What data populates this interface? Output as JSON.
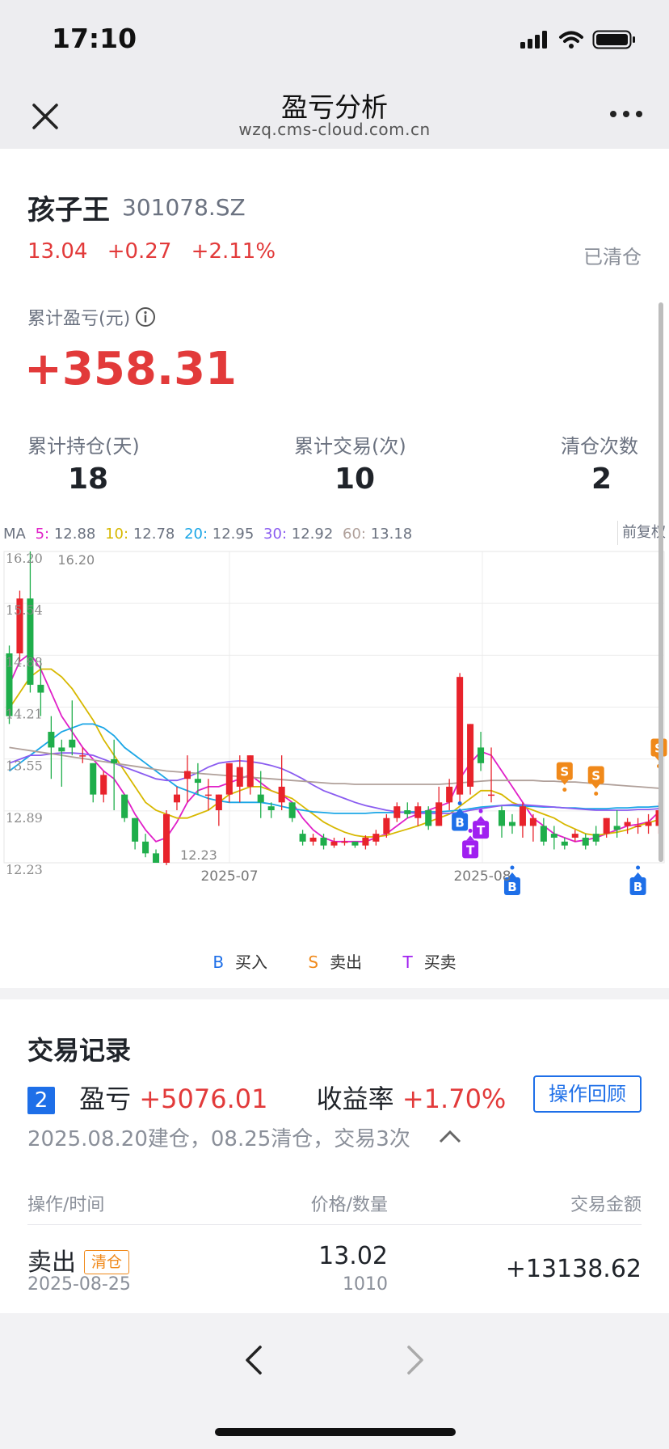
{
  "status_bar": {
    "time": "17:10"
  },
  "nav": {
    "title": "盈亏分析",
    "subtitle": "wzq.cms-cloud.com.cn"
  },
  "stock": {
    "name": "孩子王",
    "code": "301078.SZ",
    "price": "13.04",
    "change": "+0.27",
    "change_pct": "+2.11%",
    "status": "已清仓",
    "pl_label": "累计盈亏(元)",
    "pl_value": "+358.31"
  },
  "stats": [
    {
      "label": "累计持仓(天)",
      "value": "18"
    },
    {
      "label": "累计交易(次)",
      "value": "10"
    },
    {
      "label": "清仓次数",
      "value": "2"
    }
  ],
  "ma": {
    "prefix": "MA",
    "items": [
      {
        "label": "5:",
        "value": "12.88",
        "color": "#e020c8"
      },
      {
        "label": "10:",
        "value": "12.78",
        "color": "#d7b800"
      },
      {
        "label": "20:",
        "value": "12.95",
        "color": "#1aa6e6"
      },
      {
        "label": "30:",
        "value": "12.92",
        "color": "#8a5cf0"
      },
      {
        "label": "60:",
        "value": "13.18",
        "color": "#b0a09a"
      }
    ],
    "adjust": "前复权"
  },
  "chart_data": {
    "type": "candlestick",
    "y_ticks": [
      "16.20",
      "15.54",
      "14.88",
      "14.21",
      "13.55",
      "12.89",
      "12.23"
    ],
    "ylim": [
      12.23,
      16.2
    ],
    "x_labels": [
      "2025-07",
      "2025-08"
    ],
    "max_label": "16.20",
    "min_label": "12.23",
    "candles": [
      [
        14.9,
        14.1,
        15.0,
        14.0
      ],
      [
        14.9,
        15.6,
        15.7,
        14.8
      ],
      [
        15.6,
        14.5,
        16.2,
        14.4
      ],
      [
        14.5,
        14.4,
        14.8,
        14.1
      ],
      [
        13.9,
        13.7,
        14.1,
        13.3
      ],
      [
        13.7,
        13.65,
        13.8,
        13.2
      ],
      [
        13.8,
        13.7,
        14.3,
        13.6
      ],
      [
        13.6,
        13.6,
        13.7,
        13.5
      ],
      [
        13.5,
        13.1,
        13.5,
        13.0
      ],
      [
        13.1,
        13.35,
        13.4,
        13.0
      ],
      [
        13.55,
        13.5,
        13.8,
        12.9
      ],
      [
        13.1,
        12.8,
        13.1,
        12.75
      ],
      [
        12.8,
        12.5,
        12.8,
        12.4
      ],
      [
        12.5,
        12.35,
        12.6,
        12.3
      ],
      [
        12.35,
        12.23,
        12.4,
        12.23
      ],
      [
        12.23,
        12.85,
        12.9,
        12.2
      ],
      [
        13.0,
        13.1,
        13.2,
        12.9
      ],
      [
        13.3,
        13.4,
        13.6,
        13.0
      ],
      [
        13.3,
        13.25,
        13.5,
        13.1
      ],
      [
        13.1,
        13.1,
        13.3,
        12.9
      ],
      [
        12.9,
        13.1,
        13.1,
        12.7
      ],
      [
        13.1,
        13.5,
        13.5,
        13.0
      ],
      [
        13.2,
        13.45,
        13.6,
        13.0
      ],
      [
        13.2,
        13.6,
        13.6,
        13.1
      ],
      [
        13.1,
        13.0,
        13.4,
        12.8
      ],
      [
        12.95,
        12.9,
        13.0,
        12.8
      ],
      [
        13.0,
        13.2,
        13.6,
        12.9
      ],
      [
        13.0,
        12.8,
        13.0,
        12.75
      ],
      [
        12.6,
        12.5,
        12.65,
        12.45
      ],
      [
        12.5,
        12.55,
        12.6,
        12.45
      ],
      [
        12.55,
        12.45,
        12.6,
        12.4
      ],
      [
        12.45,
        12.5,
        12.55,
        12.42
      ],
      [
        12.5,
        12.5,
        12.55,
        12.45
      ],
      [
        12.5,
        12.45,
        12.5,
        12.42
      ],
      [
        12.45,
        12.55,
        12.58,
        12.4
      ],
      [
        12.5,
        12.6,
        12.65,
        12.45
      ],
      [
        12.6,
        12.8,
        12.85,
        12.55
      ],
      [
        12.8,
        12.95,
        13.0,
        12.75
      ],
      [
        12.9,
        12.85,
        13.0,
        12.8
      ],
      [
        12.8,
        12.95,
        13.0,
        12.7
      ],
      [
        12.9,
        12.7,
        12.95,
        12.65
      ],
      [
        12.7,
        13.0,
        13.2,
        12.7
      ],
      [
        13.0,
        13.2,
        13.3,
        12.9
      ],
      [
        13.1,
        14.6,
        14.65,
        13.0
      ],
      [
        13.2,
        14.0,
        14.0,
        13.1
      ],
      [
        13.7,
        13.5,
        13.9,
        13.4
      ],
      [
        13.1,
        13.1,
        13.7,
        13.0
      ],
      [
        12.9,
        12.7,
        12.95,
        12.55
      ],
      [
        12.75,
        12.7,
        12.85,
        12.6
      ],
      [
        12.7,
        12.95,
        13.0,
        12.55
      ],
      [
        12.7,
        12.8,
        12.85,
        12.5
      ],
      [
        12.7,
        12.5,
        12.8,
        12.45
      ],
      [
        12.6,
        12.55,
        12.7,
        12.4
      ],
      [
        12.5,
        12.45,
        12.55,
        12.4
      ],
      [
        12.55,
        12.6,
        12.65,
        12.5
      ],
      [
        12.55,
        12.45,
        12.6,
        12.4
      ],
      [
        12.6,
        12.5,
        12.7,
        12.45
      ],
      [
        12.6,
        12.8,
        12.8,
        12.55
      ],
      [
        12.7,
        12.65,
        12.9,
        12.55
      ],
      [
        12.7,
        12.75,
        12.8,
        12.6
      ],
      [
        12.7,
        12.7,
        12.8,
        12.6
      ],
      [
        12.7,
        12.75,
        12.85,
        12.6
      ],
      [
        12.7,
        12.9,
        13.0,
        12.6
      ]
    ],
    "series": [
      {
        "name": "MA5",
        "color": "#e020c8",
        "values": [
          14.5,
          14.8,
          14.9,
          14.7,
          14.4,
          14.1,
          13.9,
          13.7,
          13.55,
          13.4,
          13.3,
          13.1,
          12.85,
          12.65,
          12.5,
          12.55,
          12.75,
          13.0,
          13.15,
          13.2,
          13.2,
          13.25,
          13.3,
          13.35,
          13.25,
          13.15,
          13.1,
          13.0,
          12.8,
          12.65,
          12.55,
          12.5,
          12.5,
          12.5,
          12.5,
          12.55,
          12.6,
          12.7,
          12.8,
          12.85,
          12.9,
          12.95,
          13.0,
          13.3,
          13.5,
          13.65,
          13.6,
          13.4,
          13.2,
          13.0,
          12.8,
          12.7,
          12.6,
          12.55,
          12.5,
          12.52,
          12.55,
          12.6,
          12.65,
          12.7,
          12.72,
          12.75,
          12.88
        ]
      },
      {
        "name": "MA10",
        "color": "#d7b800",
        "values": [
          14.2,
          14.4,
          14.6,
          14.7,
          14.7,
          14.6,
          14.45,
          14.25,
          14.05,
          13.8,
          13.6,
          13.4,
          13.2,
          13.0,
          12.9,
          12.85,
          12.8,
          12.8,
          12.85,
          12.9,
          13.0,
          13.1,
          13.15,
          13.2,
          13.2,
          13.15,
          13.1,
          13.05,
          12.95,
          12.85,
          12.75,
          12.68,
          12.62,
          12.58,
          12.56,
          12.56,
          12.58,
          12.62,
          12.66,
          12.7,
          12.75,
          12.8,
          12.85,
          12.95,
          13.05,
          13.15,
          13.15,
          13.1,
          13.0,
          12.95,
          12.9,
          12.85,
          12.8,
          12.72,
          12.66,
          12.6,
          12.58,
          12.6,
          12.62,
          12.65,
          12.7,
          12.74,
          12.78
        ]
      },
      {
        "name": "MA20",
        "color": "#1aa6e6",
        "values": [
          13.4,
          13.5,
          13.6,
          13.7,
          13.8,
          13.9,
          13.95,
          14.0,
          14.0,
          13.95,
          13.85,
          13.7,
          13.6,
          13.5,
          13.4,
          13.3,
          13.2,
          13.15,
          13.1,
          13.05,
          13.02,
          13.0,
          13.0,
          13.0,
          13.0,
          12.98,
          12.95,
          12.92,
          12.9,
          12.88,
          12.87,
          12.86,
          12.86,
          12.86,
          12.86,
          12.87,
          12.87,
          12.87,
          12.88,
          12.88,
          12.88,
          12.88,
          12.89,
          12.9,
          12.92,
          12.94,
          12.95,
          12.96,
          12.96,
          12.95,
          12.95,
          12.94,
          12.94,
          12.93,
          12.93,
          12.92,
          12.92,
          12.92,
          12.93,
          12.93,
          12.94,
          12.94,
          12.95
        ]
      },
      {
        "name": "MA30",
        "color": "#8a5cf0",
        "values": [
          13.5,
          13.55,
          13.6,
          13.6,
          13.62,
          13.63,
          13.63,
          13.62,
          13.6,
          13.55,
          13.5,
          13.45,
          13.4,
          13.35,
          13.3,
          13.28,
          13.28,
          13.32,
          13.38,
          13.45,
          13.5,
          13.52,
          13.53,
          13.52,
          13.5,
          13.47,
          13.43,
          13.37,
          13.3,
          13.22,
          13.15,
          13.1,
          13.05,
          13.0,
          12.96,
          12.93,
          12.9,
          12.88,
          12.87,
          12.86,
          12.86,
          12.86,
          12.86,
          12.87,
          12.9,
          12.92,
          12.94,
          12.96,
          12.97,
          12.97,
          12.96,
          12.95,
          12.94,
          12.93,
          12.92,
          12.91,
          12.9,
          12.9,
          12.9,
          12.9,
          12.91,
          12.91,
          12.92
        ]
      },
      {
        "name": "MA60",
        "color": "#b0a09a",
        "values": [
          13.7,
          13.68,
          13.66,
          13.64,
          13.62,
          13.6,
          13.58,
          13.56,
          13.54,
          13.52,
          13.5,
          13.48,
          13.46,
          13.44,
          13.42,
          13.4,
          13.39,
          13.38,
          13.37,
          13.36,
          13.35,
          13.34,
          13.33,
          13.32,
          13.31,
          13.3,
          13.29,
          13.28,
          13.27,
          13.26,
          13.25,
          13.24,
          13.24,
          13.23,
          13.23,
          13.23,
          13.23,
          13.23,
          13.23,
          13.23,
          13.23,
          13.23,
          13.24,
          13.25,
          13.26,
          13.27,
          13.28,
          13.28,
          13.28,
          13.28,
          13.28,
          13.27,
          13.27,
          13.26,
          13.26,
          13.25,
          13.24,
          13.23,
          13.22,
          13.21,
          13.2,
          13.19,
          13.18
        ]
      }
    ],
    "markers": [
      {
        "i": 43,
        "type": "B",
        "price": 13.05
      },
      {
        "i": 44,
        "type": "T",
        "price": 12.7
      },
      {
        "i": 45,
        "type": "T",
        "price": 12.95
      },
      {
        "i": 48,
        "type": "B",
        "price": 12.23
      },
      {
        "i": 53,
        "type": "S",
        "price": 13.1
      },
      {
        "i": 56,
        "type": "S",
        "price": 13.05
      },
      {
        "i": 60,
        "type": "B",
        "price": 12.23
      },
      {
        "i": 62,
        "type": "S",
        "price": 13.4
      }
    ]
  },
  "legend": [
    {
      "symbol": "B",
      "label": "买入",
      "color": "#1e6fe8"
    },
    {
      "symbol": "S",
      "label": "卖出",
      "color": "#f0891a"
    },
    {
      "symbol": "T",
      "label": "买卖",
      "color": "#a020f0"
    }
  ],
  "records": {
    "title": "交易记录",
    "index": "2",
    "pl_label": "盈亏",
    "pl_value": "+5076.01",
    "rate_label": "收益率",
    "rate_value": "+1.70%",
    "review_btn": "操作回顾",
    "summary": "2025.08.20建仓，08.25清仓，交易3次",
    "columns": [
      "操作/时间",
      "价格/数量",
      "交易金额"
    ],
    "rows": [
      {
        "action": "卖出",
        "tag": "清仓",
        "date": "2025-08-25",
        "price": "13.02",
        "qty": "1010",
        "amount": "+13138.62"
      }
    ]
  }
}
